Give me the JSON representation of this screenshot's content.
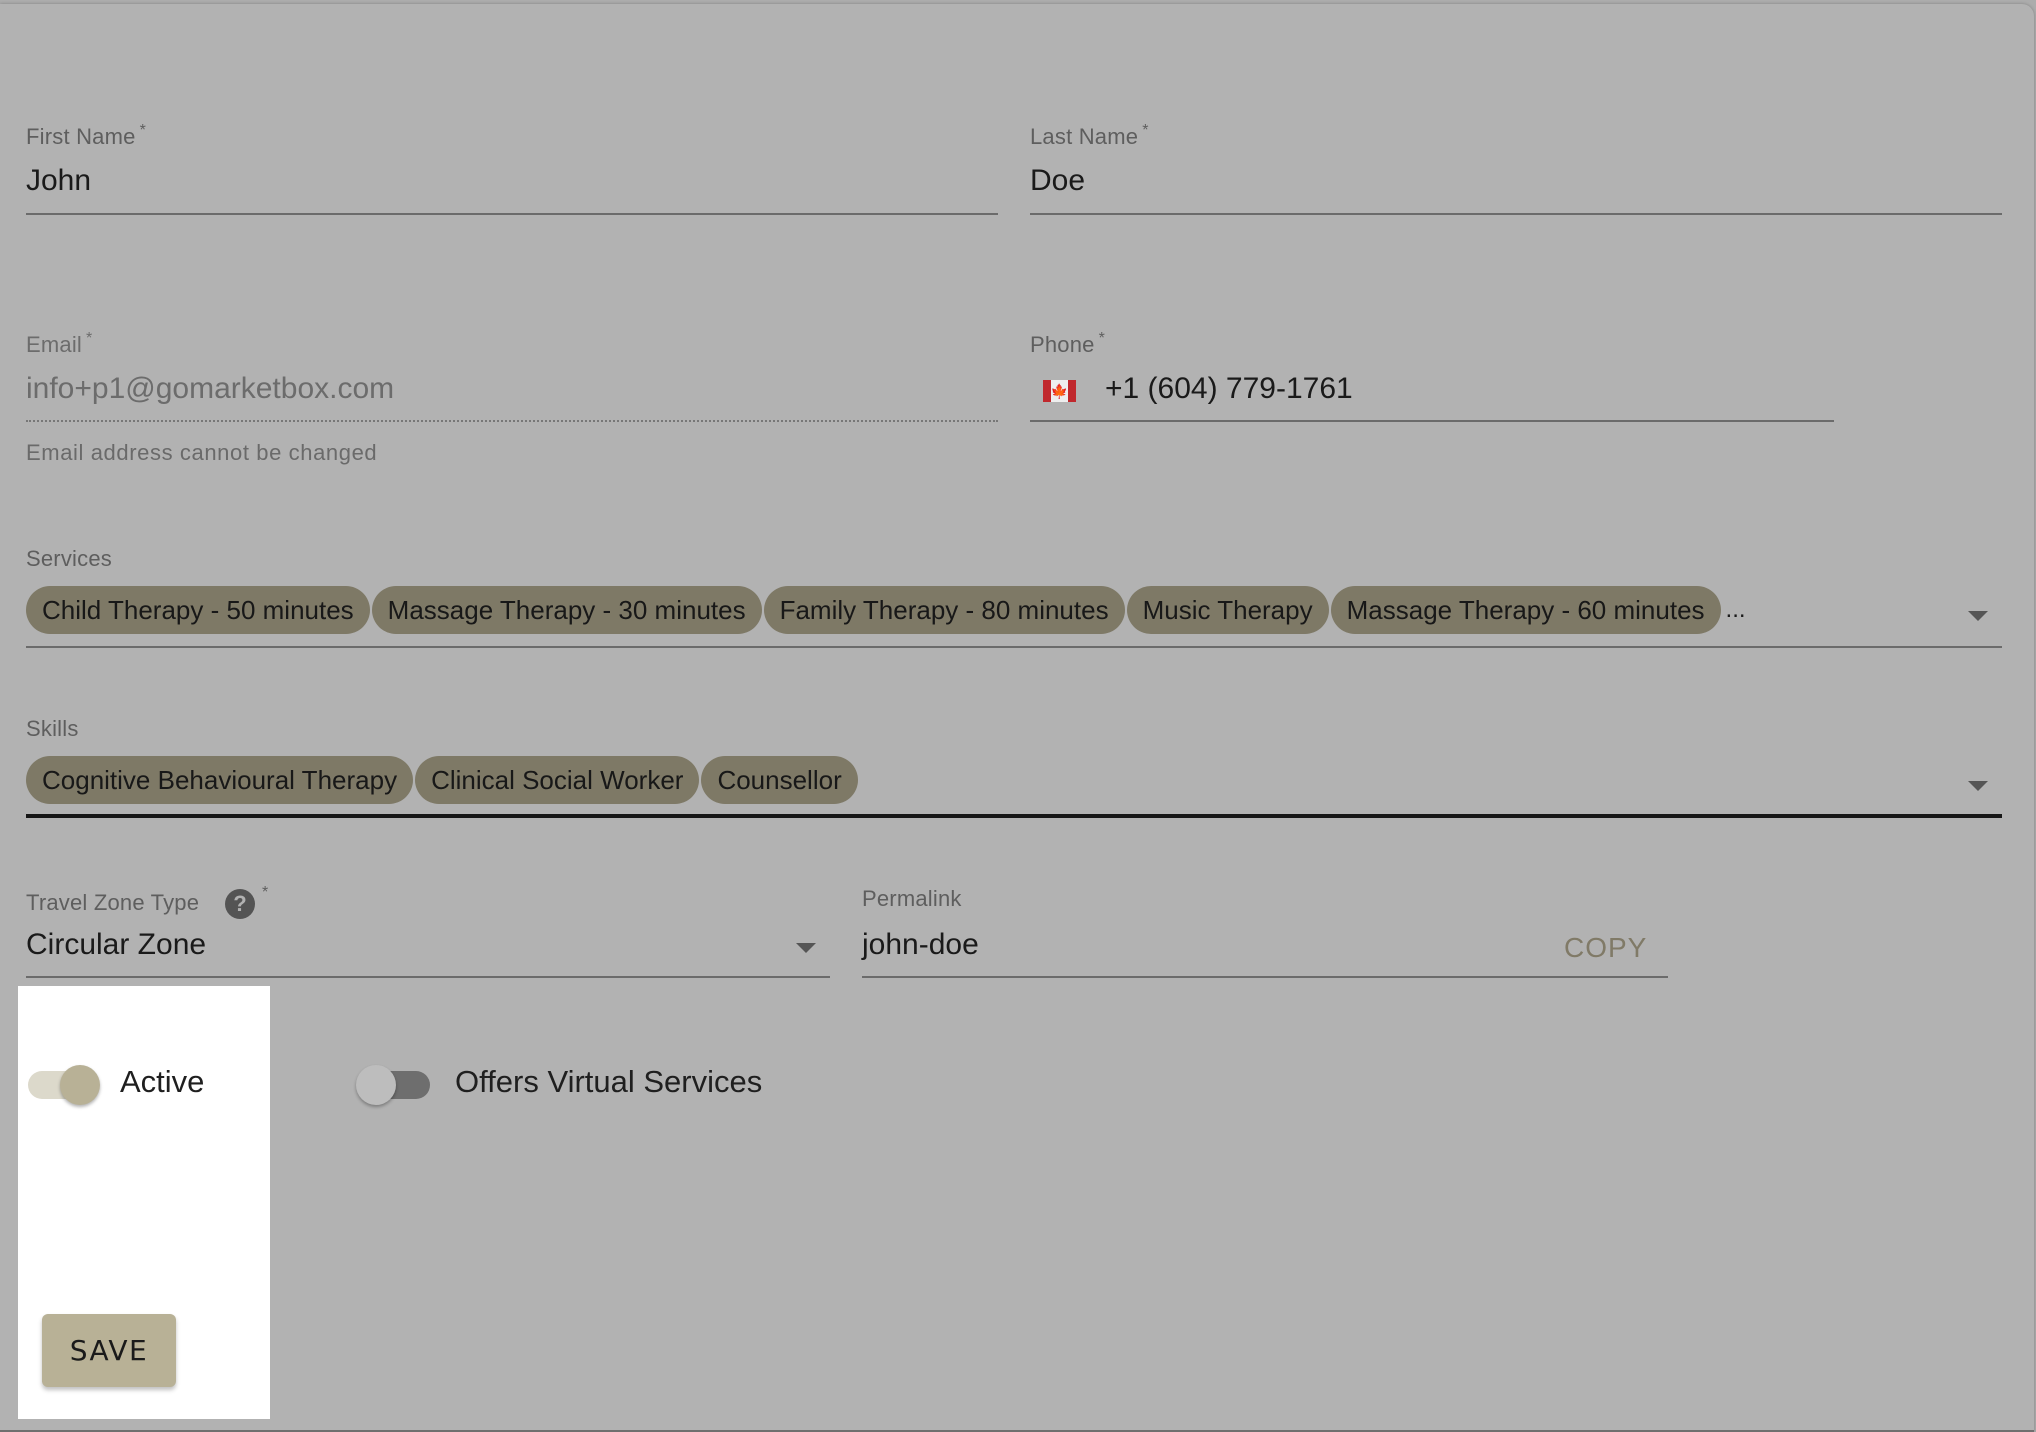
{
  "form": {
    "first_name": {
      "label": "First Name",
      "required_mark": "*",
      "value": "John"
    },
    "last_name": {
      "label": "Last Name",
      "required_mark": "*",
      "value": "Doe"
    },
    "email": {
      "label": "Email",
      "required_mark": "*",
      "value": "info+p1@gomarketbox.com",
      "helper": "Email address cannot be changed",
      "disabled": true
    },
    "phone": {
      "label": "Phone",
      "required_mark": "*",
      "country_flag": "canada-flag",
      "flag_glyph": "🍁",
      "value": "+1 (604) 779-1761"
    },
    "services": {
      "label": "Services",
      "chips": [
        "Child Therapy - 50 minutes",
        "Massage Therapy - 30 minutes",
        "Family Therapy - 80 minutes",
        "Music Therapy",
        "Massage Therapy - 60 minutes"
      ],
      "overflow": "..."
    },
    "skills": {
      "label": "Skills",
      "chips": [
        "Cognitive Behavioural Therapy",
        "Clinical Social Worker",
        "Counsellor"
      ]
    },
    "travel_zone": {
      "label": "Travel Zone Type",
      "help_glyph": "?",
      "required_mark": "*",
      "value": "Circular Zone"
    },
    "permalink": {
      "label": "Permalink",
      "value": "john-doe",
      "copy_label": "COPY"
    },
    "toggles": {
      "active": {
        "label": "Active",
        "on": true
      },
      "virtual": {
        "label": "Offers Virtual Services",
        "on": false
      }
    },
    "save_label": "SAVE"
  },
  "colors": {
    "chip": "#7e7966",
    "accent": "#b8b196",
    "toggle_on_track": "#dcd9cb",
    "toggle_on_thumb": "#b8b196",
    "toggle_off_track": "#6e6e6e",
    "toggle_off_thumb": "#bdbdbd"
  }
}
